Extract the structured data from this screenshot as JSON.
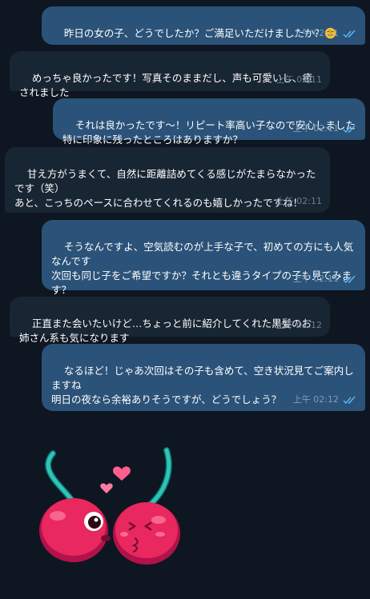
{
  "messages": [
    {
      "dir": "out",
      "text": "昨日の女の子、どうでしたか？ご満足いただけましたか？",
      "emoji": "smiling-face-icon",
      "time": "上午 02:11",
      "read": true
    },
    {
      "dir": "in",
      "text": "めっちゃ良かったです！写真そのままだし、声も可愛いし、癒されました",
      "time": "上午 02:11"
    },
    {
      "dir": "out",
      "text": "それは良かったです～！リピート率高い子なので安心しました\n特に印象に残ったところはありますか？",
      "time": "上午 02:11",
      "read": true
    },
    {
      "dir": "in",
      "text": "甘え方がうまくて、自然に距離詰めてくる感じがたまらなかったです（笑）\nあと、こっちのペースに合わせてくれるのも嬉しかったですね！",
      "time": "上午 02:11"
    },
    {
      "dir": "out",
      "text": "そうなんですよ、空気読むのが上手な子で、初めての方にも人気なんです\n次回も同じ子をご希望ですか？それとも違うタイプの子も見てみます？",
      "time": "上午 02:11",
      "read": true
    },
    {
      "dir": "in",
      "text": "正直また会いたいけど…ちょっと前に紹介してくれた黒髪のお姉さん系も気になります",
      "time": "上午 02:12"
    },
    {
      "dir": "out",
      "text": "なるほど！じゃあ次回はその子も含めて、空き状況見てご案内しますね\n明日の夜なら余裕ありそうですが、どうでしょう？",
      "time": "上午 02:12",
      "read": true
    }
  ],
  "sticker": {
    "name": "kissing-cherries-sticker",
    "color": "#e8285e",
    "stem_color": "#2ec4b6"
  },
  "colors": {
    "background": "#0e1621",
    "outgoing": "#2b5278",
    "incoming": "#182533",
    "tick": "#5eb5f7"
  }
}
